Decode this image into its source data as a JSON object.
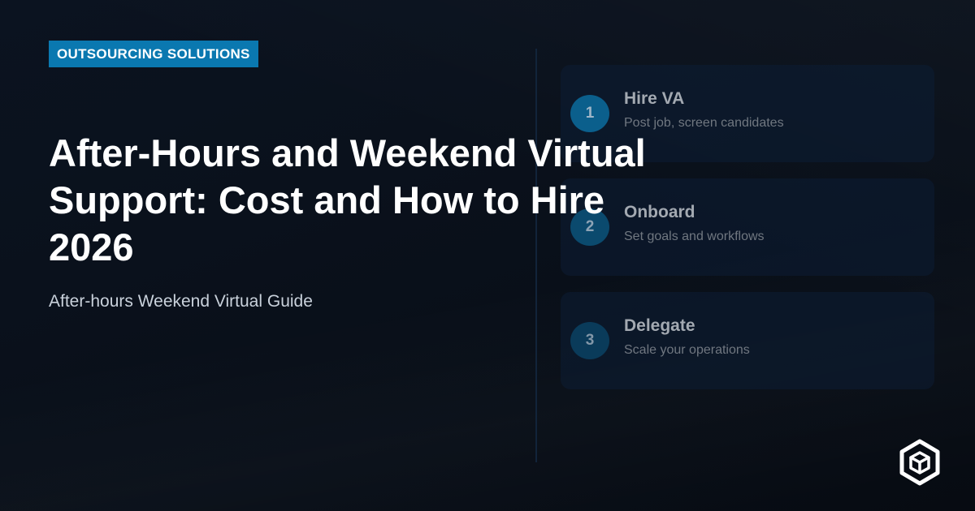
{
  "badge": {
    "label": "OUTSOURCING SOLUTIONS"
  },
  "headline": {
    "title_line1": "After-Hours and Weekend Virtual",
    "title_line2": "Support: Cost and How to Hire",
    "title_line3": "2026",
    "subtitle": "After-hours Weekend Virtual Guide"
  },
  "steps": [
    {
      "number": "1",
      "label": "Hire VA",
      "description": "Post job, screen candidates",
      "circle_color": "#0b5f8c",
      "number_color": "#9fb6c8"
    },
    {
      "number": "2",
      "label": "Onboard",
      "description": "Set goals and workflows",
      "circle_color": "#0b4a6e",
      "number_color": "#8ea4b6"
    },
    {
      "number": "3",
      "label": "Delegate",
      "description": "Scale your operations",
      "circle_color": "#0a3b5a",
      "number_color": "#8297a8"
    }
  ],
  "colors": {
    "accent": "#0a78b0",
    "background": "#0a111c"
  },
  "logo": {
    "icon": "cube-hexagon-logo-icon"
  }
}
